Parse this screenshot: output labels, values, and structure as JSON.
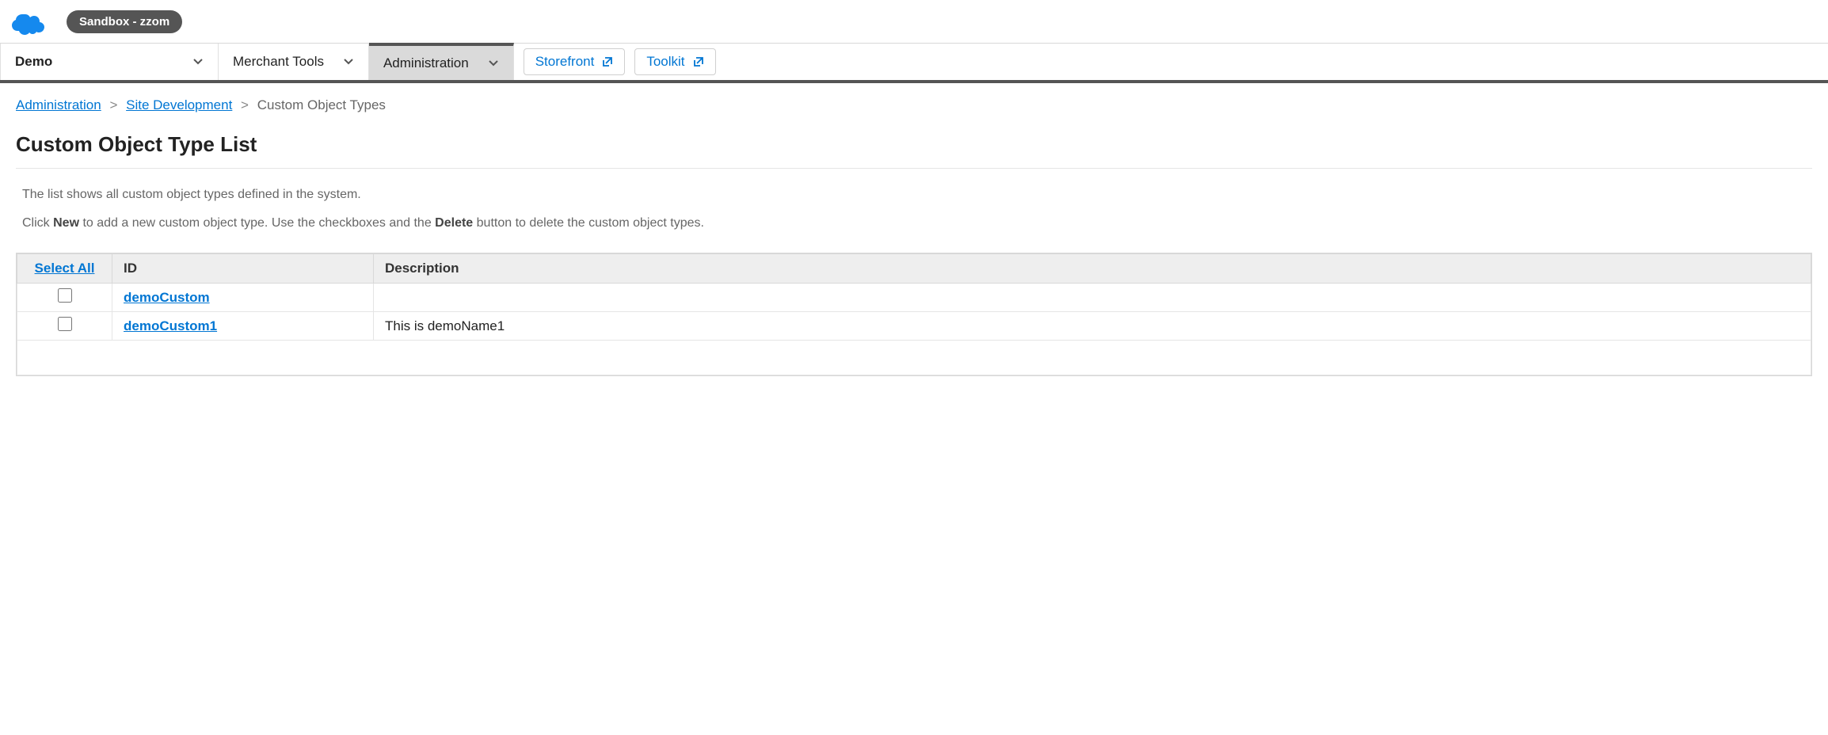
{
  "header": {
    "sandbox_label": "Sandbox - zzom"
  },
  "nav": {
    "site": "Demo",
    "merchant_tools": "Merchant Tools",
    "administration": "Administration",
    "storefront": "Storefront",
    "toolkit": "Toolkit"
  },
  "breadcrumb": {
    "administration": "Administration",
    "site_development": "Site Development",
    "current": "Custom Object Types"
  },
  "page": {
    "title": "Custom Object Type List",
    "help1": "The list shows all custom object types defined in the system.",
    "help2_a": "Click ",
    "help2_new": "New",
    "help2_b": " to add a new custom object type. Use the checkboxes and the ",
    "help2_delete": "Delete",
    "help2_c": " button to delete the custom object types."
  },
  "table": {
    "select_all": "Select All",
    "col_id": "ID",
    "col_description": "Description",
    "rows": [
      {
        "id": "demoCustom",
        "description": ""
      },
      {
        "id": "demoCustom1",
        "description": "This is demoName1"
      }
    ]
  }
}
